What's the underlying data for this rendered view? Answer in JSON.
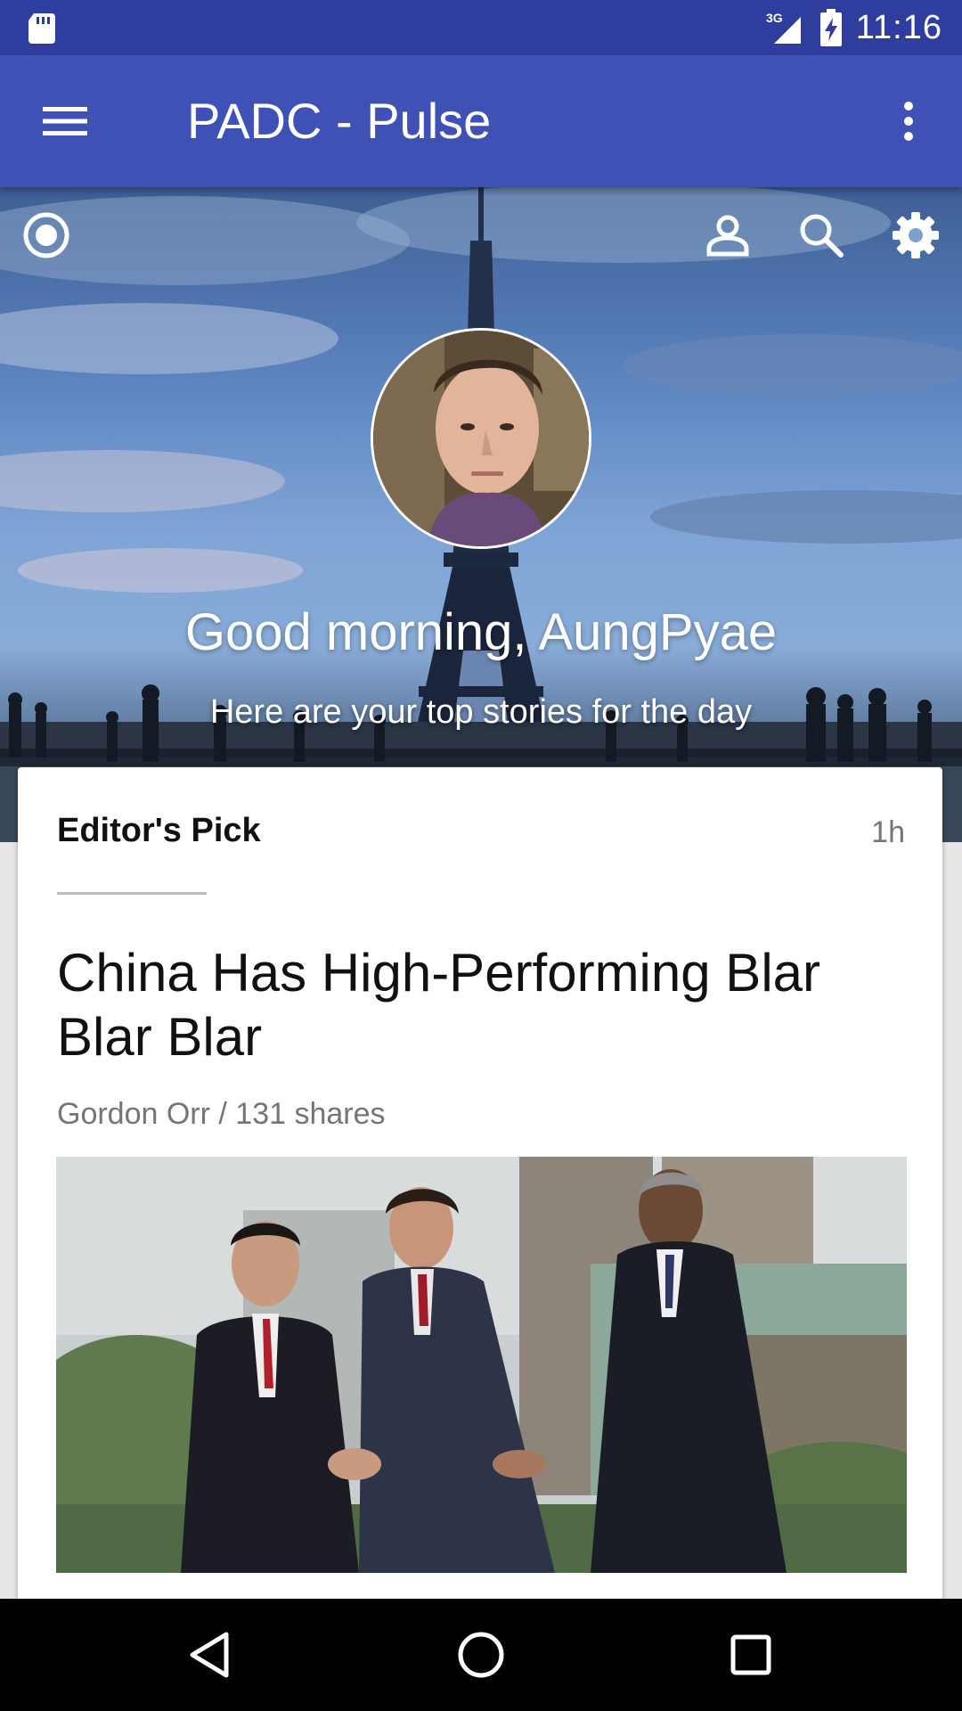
{
  "status_bar": {
    "network": "3G",
    "time": "11:16",
    "sd_icon": "sd-card-icon",
    "signal_icon": "cell-signal-icon",
    "battery_icon": "battery-charging-icon"
  },
  "app_bar": {
    "title": "PADC - Pulse",
    "menu_icon": "hamburger-menu-icon",
    "overflow_icon": "more-vert-icon",
    "background_color": "#3f51b5"
  },
  "hero": {
    "greeting": "Good morning, AungPyae",
    "subtitle": "Here are your top stories for the day",
    "icons": [
      "radio-target-icon",
      "person-icon",
      "search-icon",
      "settings-gear-icon"
    ]
  },
  "story_card": {
    "category": "Editor's Pick",
    "time_ago": "1h",
    "headline": "China Has High-Performing Blar Blar Blar",
    "author": "Gordon Orr",
    "shares": "131 shares",
    "meta": "Gordon Orr / 131 shares"
  },
  "nav_bar": {
    "icons": [
      "back-icon",
      "home-icon",
      "recents-icon"
    ]
  },
  "colors": {
    "status_bar": "#2f3e9e",
    "app_bar": "#3f51b5",
    "page_background": "#e6e6e6"
  }
}
